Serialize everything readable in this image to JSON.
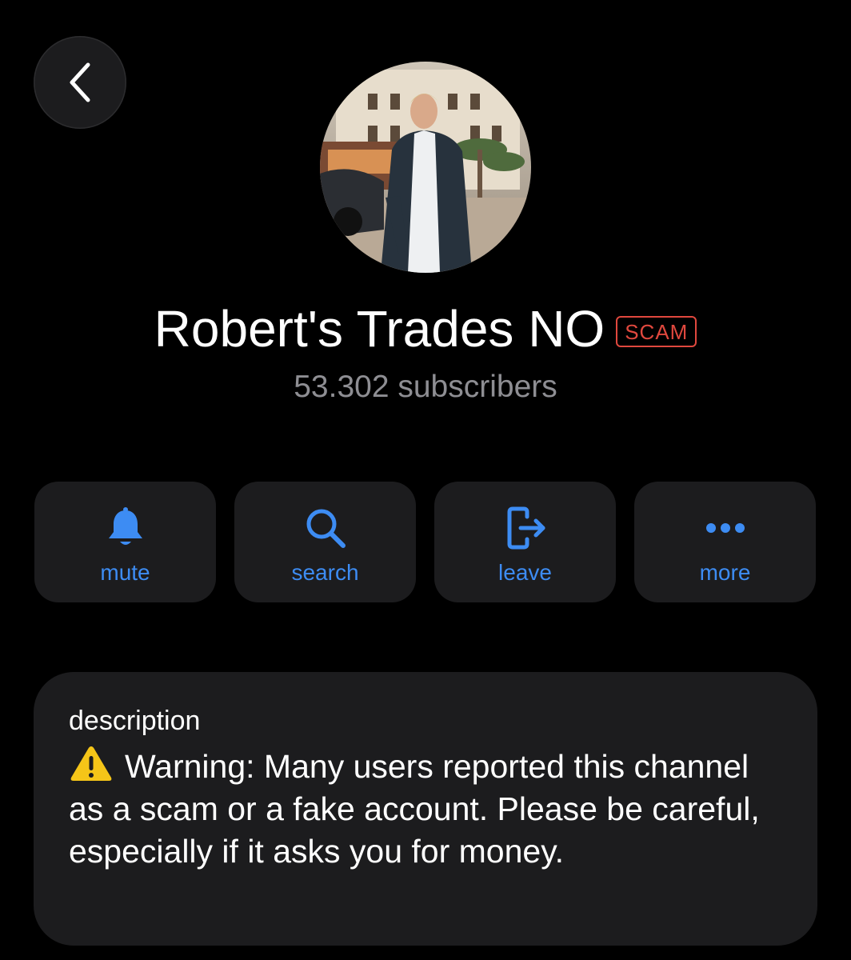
{
  "header": {
    "back_icon": "chevron-left-icon"
  },
  "channel": {
    "name": "Robert's Trades NO",
    "badge": "SCAM",
    "subscribers": "53.302 subscribers"
  },
  "actions": [
    {
      "label": "mute",
      "icon": "bell-icon"
    },
    {
      "label": "search",
      "icon": "search-icon"
    },
    {
      "label": "leave",
      "icon": "leave-icon"
    },
    {
      "label": "more",
      "icon": "more-dots-icon"
    }
  ],
  "description": {
    "label": "description",
    "icon": "warning-icon",
    "text": "Warning: Many users reported this channel as a scam or a fake account. Please be careful, especially if it asks you for money."
  },
  "colors": {
    "background": "#000000",
    "card": "#1c1c1e",
    "accent": "#3d8cf3",
    "scam_badge": "#e0483e",
    "secondary_text": "#8e8e93"
  }
}
